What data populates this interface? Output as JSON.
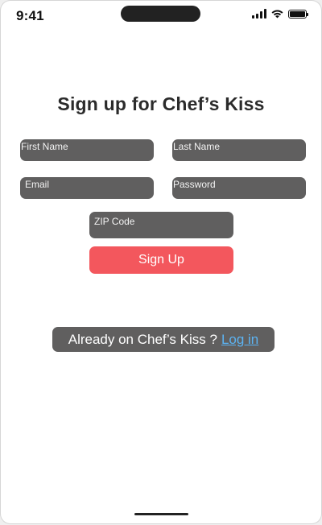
{
  "status_bar": {
    "time": "9:41",
    "icons": [
      "signal-icon",
      "wifi-icon",
      "battery-icon"
    ]
  },
  "title": "Sign up for Chef’s Kiss",
  "form": {
    "first_name_placeholder": "First Name",
    "last_name_placeholder": "Last Name",
    "email_placeholder": "Email",
    "password_placeholder": "Password",
    "zip_placeholder": "ZIP Code",
    "submit_label": "Sign Up"
  },
  "login_prompt": {
    "text": "Already on Chef’s Kiss ?",
    "link_label": "Log in"
  },
  "colors": {
    "field_background": "#605f5f",
    "primary_button": "#f3575d",
    "link": "#5cb3f2",
    "title": "#2b2b2b"
  }
}
